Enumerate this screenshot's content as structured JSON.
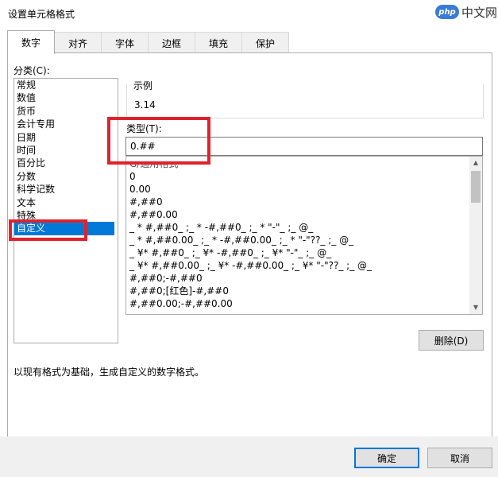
{
  "window": {
    "title": "设置单元格格式"
  },
  "watermark": {
    "logo": "php",
    "text": "中文网"
  },
  "tabs": [
    {
      "label": "数字",
      "active": true
    },
    {
      "label": "对齐",
      "active": false
    },
    {
      "label": "字体",
      "active": false
    },
    {
      "label": "边框",
      "active": false
    },
    {
      "label": "填充",
      "active": false
    },
    {
      "label": "保护",
      "active": false
    }
  ],
  "category": {
    "label": "分类(C):",
    "items": [
      "常规",
      "数值",
      "货币",
      "会计专用",
      "日期",
      "时间",
      "百分比",
      "分数",
      "科学记数",
      "文本",
      "特殊",
      "自定义"
    ],
    "selected": "自定义"
  },
  "sample": {
    "label": "示例",
    "value": "3.14"
  },
  "type_field": {
    "label": "类型(T):",
    "value": "0.##"
  },
  "format_list": {
    "items": [
      "G/通用格式",
      "0",
      "0.00",
      "#,##0",
      "#,##0.00",
      "_ * #,##0_ ;_ * -#,##0_ ;_ * \"-\"_ ;_ @_",
      "_ * #,##0.00_ ;_ * -#,##0.00_ ;_ * \"-\"??_ ;_ @_",
      "_ ¥* #,##0_ ;_ ¥* -#,##0_ ;_ ¥* \"-\"_ ;_ @_",
      "_ ¥* #,##0.00_ ;_ ¥* -#,##0.00_ ;_ ¥* \"-\"??_ ;_ @_",
      "#,##0;-#,##0",
      "#,##0;[红色]-#,##0",
      "#,##0.00;-#,##0.00"
    ]
  },
  "buttons": {
    "delete": "删除(D)",
    "ok": "确定",
    "cancel": "取消"
  },
  "description": "以现有格式为基础，生成自定义的数字格式。",
  "colors": {
    "selection": "#0078d7",
    "highlight": "#e0222d"
  }
}
